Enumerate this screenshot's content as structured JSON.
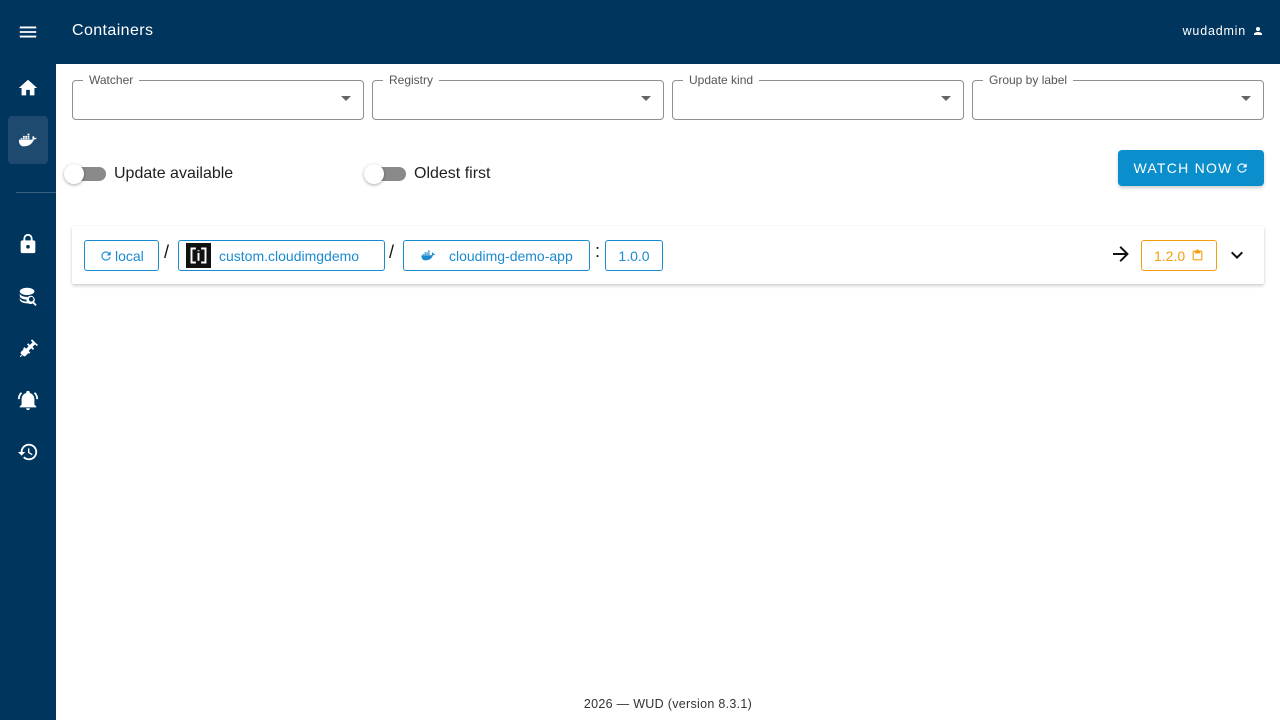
{
  "app": {
    "title": "Containers",
    "user": "wudadmin"
  },
  "sidebar": {
    "items": [
      {
        "icon": "menu-icon"
      },
      {
        "icon": "home-icon"
      },
      {
        "icon": "docker-icon",
        "active": true
      },
      {
        "icon": "lock-icon"
      },
      {
        "icon": "database-search-icon"
      },
      {
        "icon": "plug-icon"
      },
      {
        "icon": "bell-ring-icon"
      },
      {
        "icon": "history-icon"
      }
    ]
  },
  "filters": {
    "watcher": {
      "label": "Watcher",
      "value": ""
    },
    "registry": {
      "label": "Registry",
      "value": ""
    },
    "update_kind": {
      "label": "Update kind",
      "value": ""
    },
    "group_by_label": {
      "label": "Group by label",
      "value": ""
    }
  },
  "toggles": {
    "update_available": {
      "label": "Update available",
      "checked": false
    },
    "oldest_first": {
      "label": "Oldest first",
      "checked": false
    }
  },
  "actions": {
    "watch_now": "WATCH NOW"
  },
  "container": {
    "watcher": "local",
    "registry": "custom.cloudimgdemo",
    "image": "cloudimg-demo-app",
    "tag": "1.0.0",
    "update_tag": "1.2.0",
    "separator_slash": "/",
    "separator_colon": ":"
  },
  "footer": {
    "text": "2026 — WUD (version 8.3.1)"
  },
  "colors": {
    "primary_dark": "#00355e",
    "accent_blue": "#0a8ecc",
    "chip_blue": "#1b8bd1",
    "warning_orange": "#f59e0b"
  }
}
